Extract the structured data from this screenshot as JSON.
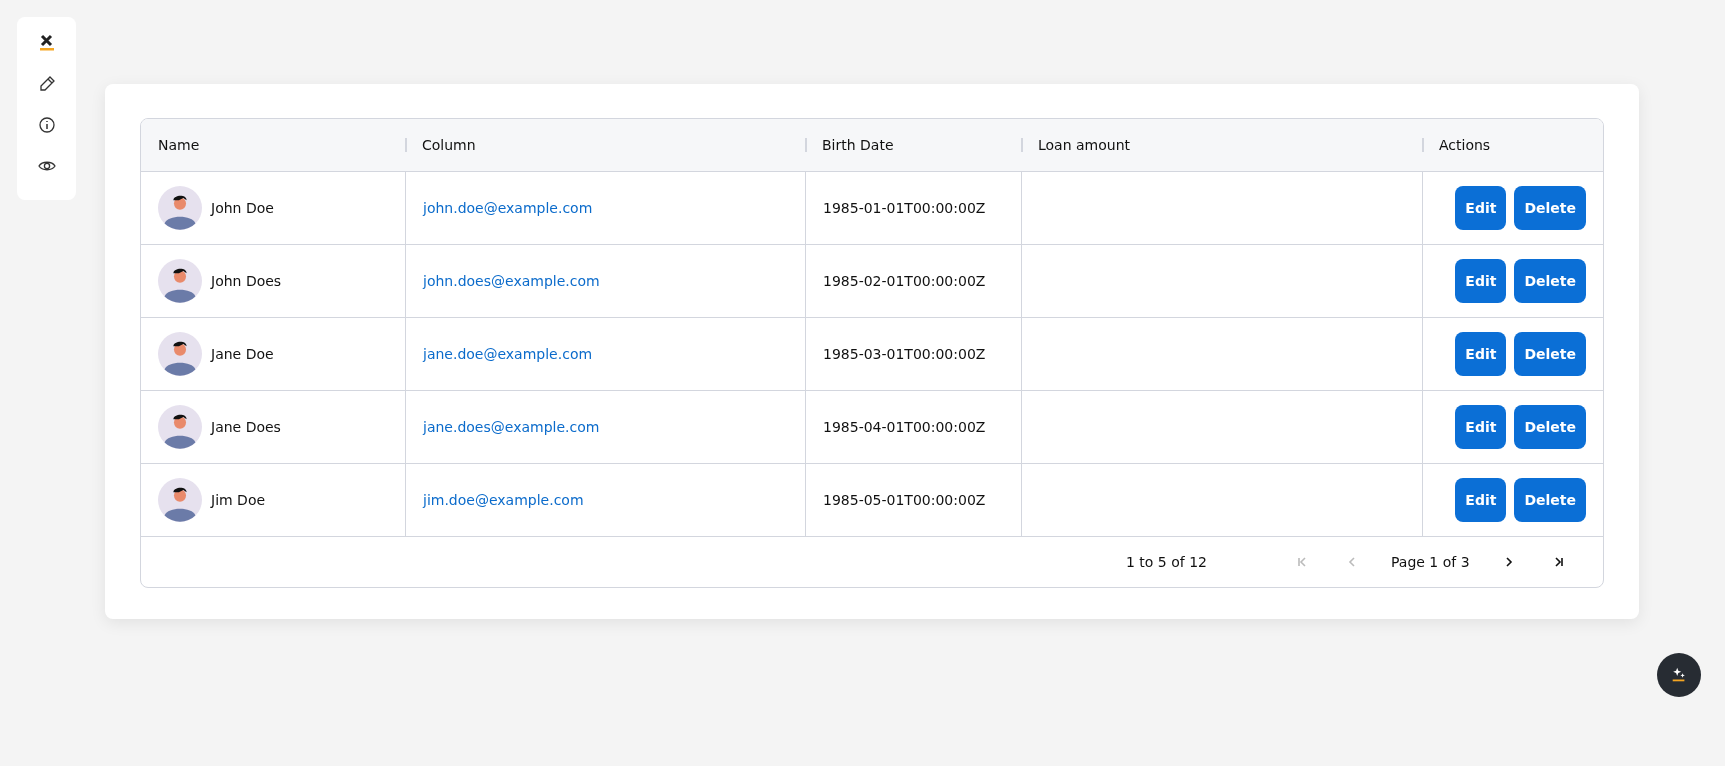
{
  "table": {
    "columns": [
      "Name",
      "Column",
      "Birth Date",
      "Loan amount",
      "Actions"
    ],
    "rows": [
      {
        "name": "John Doe",
        "email": "john.doe@example.com",
        "birth_date": "1985-01-01T00:00:00Z",
        "actions": [
          "Edit",
          "Delete"
        ]
      },
      {
        "name": "John Does",
        "email": "john.does@example.com",
        "birth_date": "1985-02-01T00:00:00Z",
        "actions": [
          "Edit",
          "Delete"
        ]
      },
      {
        "name": "Jane Doe",
        "email": "jane.doe@example.com",
        "birth_date": "1985-03-01T00:00:00Z",
        "actions": [
          "Edit",
          "Delete"
        ]
      },
      {
        "name": "Jane Does",
        "email": "jane.does@example.com",
        "birth_date": "1985-04-01T00:00:00Z",
        "actions": [
          "Edit",
          "Delete"
        ]
      },
      {
        "name": "Jim Doe",
        "email": "jim.doe@example.com",
        "birth_date": "1985-05-01T00:00:00Z",
        "actions": [
          "Edit",
          "Delete"
        ]
      }
    ]
  },
  "pagination": {
    "summary": "1 to 5 of 12",
    "page_label": "Page 1 of 3",
    "buttons": [
      {
        "kind": "first",
        "disabled": true
      },
      {
        "kind": "prev",
        "disabled": true
      },
      {
        "kind": "next",
        "disabled": false
      },
      {
        "kind": "last",
        "disabled": false
      }
    ]
  }
}
